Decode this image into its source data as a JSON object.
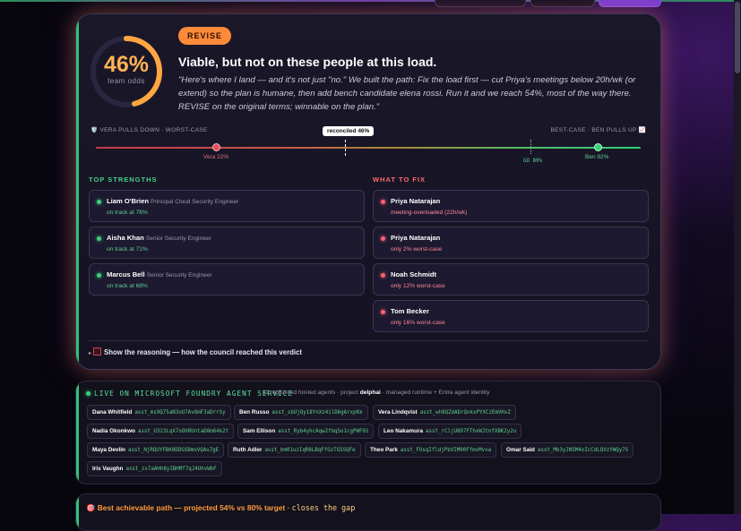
{
  "verdict": {
    "badge": "REVISE",
    "gauge_value": "46%",
    "gauge_label": "team odds",
    "gauge_fraction": 0.46,
    "headline": "Viable, but not on these people at this load.",
    "quote": "\"Here's where I land — and it's not just \"no.\" We built the path: Fix the load first — cut Priya's meetings below 20h/wk (or extend) so the plan is humane, then add bench candidate elena rossi. Run it and we reach 54%, most of the way there. REVISE on the original terms; winnable on the plan.\""
  },
  "range": {
    "left_label": "🛡️ VERA PULLS DOWN · WORST-CASE",
    "right_label": "BEST-CASE · BEN PULLS UP 📈",
    "reconciled": "reconciled 46%",
    "vera": "Vera 22%",
    "go": "GO 80%",
    "ben": "Ben 92%"
  },
  "strengths": {
    "title": "TOP STRENGTHS",
    "items": [
      {
        "name": "Liam O'Brien",
        "role": "Principal Cloud Security Engineer",
        "status": "on track at 76%"
      },
      {
        "name": "Aisha Khan",
        "role": "Senior Security Engineer",
        "status": "on track at 71%"
      },
      {
        "name": "Marcus Bell",
        "role": "Senior Security Engineer",
        "status": "on track at 68%"
      }
    ]
  },
  "fixes": {
    "title": "WHAT TO FIX",
    "items": [
      {
        "name": "Priya Natarajan",
        "status": "meeting-overloaded (22h/wk)"
      },
      {
        "name": "Priya Natarajan",
        "status": "only 2% worst-case"
      },
      {
        "name": "Noah Schmidt",
        "status": "only 12% worst-case"
      },
      {
        "name": "Tom Becker",
        "status": "only 16% worst-case"
      }
    ]
  },
  "reasoning_toggle": "Show the reasoning — how the council reached this verdict",
  "foundry": {
    "title": "LIVE ON MICROSOFT FOUNDRY AGENT SERVICE",
    "meta_prefix": "11 registered hosted agents · project",
    "project": "delphai",
    "meta_suffix": "· managed runtime + Entra agent identity",
    "agents": [
      {
        "name": "Dana Whitfield",
        "id": "asst_ms9Q75aN3oU7AvOmF3aDrrSy"
      },
      {
        "name": "Ben Russo",
        "id": "asst_sbUjQy18YnXz4ilD6gArxpKk"
      },
      {
        "name": "Vera Lindqvist",
        "id": "asst_wh8QZdADrQnkxPYXCzEmVHxZ"
      },
      {
        "name": "Nadia Okonkwo",
        "id": "asst_U323LqX7oOhRUntaD8m64k2t"
      },
      {
        "name": "Sam Ellison",
        "id": "asst_Ryb4yhcAqw2fbqSo1cgPWF01"
      },
      {
        "name": "Leo Nakamura",
        "id": "asst_rCljU897FThxWJtnfXBK2y2u"
      },
      {
        "name": "Maya Devlin",
        "id": "asst_NjRQUYFBK0DDGSBmoVQAu7gE"
      },
      {
        "name": "Ruth Adler",
        "id": "asst_bm01uzIqR8LBqFfGzTG5SQFe"
      },
      {
        "name": "Theo Park",
        "id": "asst_FUsqIfldjPbVIM00FfmvMvva"
      },
      {
        "name": "Omar Said",
        "id": "asst_Mb3yJNSM4oIcCdLQVzYWQy7S"
      },
      {
        "name": "Iris Vaughn",
        "id": "asst_zx7aAHh8yIBHMf7qJ4UhvWbF"
      }
    ]
  },
  "best_path": {
    "text": "🎯 Best achievable path — projected 54% vs 80% target ·",
    "mono": "closes the gap"
  },
  "colors": {
    "accent_orange": "#ff8a3a",
    "accent_green": "#3bd07a",
    "accent_red": "#ff6070"
  }
}
